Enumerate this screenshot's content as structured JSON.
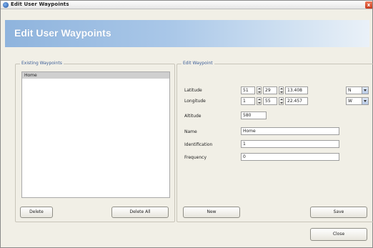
{
  "window": {
    "title": "Edit User Waypoints",
    "close_glyph": "x"
  },
  "banner": {
    "title": "Edit User Waypoints"
  },
  "existing": {
    "legend": "Existing Waypoints",
    "items": [
      "Home"
    ],
    "selected_index": 0,
    "delete_label": "Delete",
    "delete_all_label": "Delete All"
  },
  "edit": {
    "legend": "Edit Waypoint",
    "latitude": {
      "label": "Latitude",
      "deg": "51",
      "min": "29",
      "sec": "13.408",
      "hemisphere": "N"
    },
    "longitude": {
      "label": "Longitude",
      "deg": "1",
      "min": "55",
      "sec": "22.457",
      "hemisphere": "W"
    },
    "altitude": {
      "label": "Altitude",
      "value": "580"
    },
    "name": {
      "label": "Name",
      "value": "Home"
    },
    "identification": {
      "label": "Identification",
      "value": "1"
    },
    "frequency": {
      "label": "Frequency",
      "value": "0"
    },
    "new_label": "New",
    "save_label": "Save"
  },
  "footer": {
    "close_label": "Close"
  }
}
